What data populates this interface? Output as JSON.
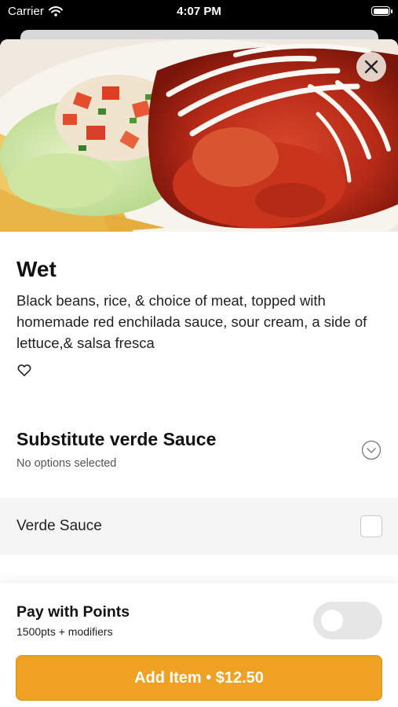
{
  "status_bar": {
    "carrier": "Carrier",
    "time": "4:07 PM",
    "battery_level": 1.0
  },
  "hero": {
    "image": "wet-burrito-photo",
    "close_icon": "close-icon"
  },
  "item": {
    "title": "Wet",
    "description": "Black beans, rice, & choice of meat, topped with homemade red enchilada sauce, sour cream, a side of lettuce,& salsa fresca",
    "favorite_icon": "heart-outline-icon",
    "favorited": false
  },
  "modifier_group": {
    "title": "Substitute verde Sauce",
    "subtitle": "No options selected",
    "expand_icon": "chevron-down-circle-icon",
    "options": [
      {
        "label": "Verde Sauce",
        "checked": false
      }
    ]
  },
  "footer": {
    "points_title": "Pay with Points",
    "points_subtitle": "1500pts + modifiers",
    "points_toggle_on": false,
    "add_button_label": "Add Item • $12.50"
  },
  "colors": {
    "accent": "#eea122",
    "toggle_off": "#e6e6e6",
    "option_row_bg": "#f5f5f5"
  }
}
